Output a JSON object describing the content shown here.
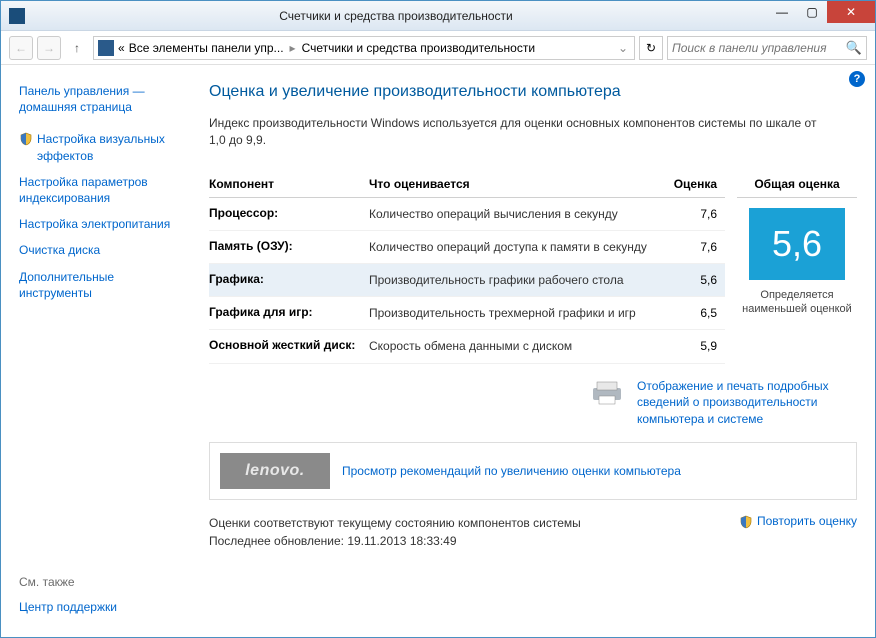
{
  "window": {
    "title": "Счетчики и средства производительности"
  },
  "breadcrumb": {
    "prefix": "«",
    "parent": "Все элементы панели упр...",
    "current": "Счетчики и средства производительности"
  },
  "search": {
    "placeholder": "Поиск в панели управления"
  },
  "sidebar": {
    "home": "Панель управления — домашняя страница",
    "items": [
      "Настройка визуальных эффектов",
      "Настройка параметров индексирования",
      "Настройка электропитания",
      "Очистка диска",
      "Дополнительные инструменты"
    ],
    "see_also": "См. также",
    "support": "Центр поддержки"
  },
  "main": {
    "heading": "Оценка и увеличение производительности компьютера",
    "intro": "Индекс производительности Windows используется для оценки основных компонентов системы по шкале от 1,0 до 9,9.",
    "headers": {
      "component": "Компонент",
      "description": "Что оценивается",
      "score": "Оценка",
      "overall": "Общая оценка"
    },
    "rows": [
      {
        "component": "Процессор:",
        "description": "Количество операций вычисления в секунду",
        "score": "7,6"
      },
      {
        "component": "Память (ОЗУ):",
        "description": "Количество операций доступа к памяти в секунду",
        "score": "7,6"
      },
      {
        "component": "Графика:",
        "description": "Производительность графики рабочего стола",
        "score": "5,6"
      },
      {
        "component": "Графика для игр:",
        "description": "Производительность трехмерной графики и игр",
        "score": "6,5"
      },
      {
        "component": "Основной жесткий диск:",
        "description": "Скорость обмена данными с диском",
        "score": "5,9"
      }
    ],
    "overall_score": "5,6",
    "overall_caption": "Определяется наименьшей оценкой",
    "detail_link": "Отображение и печать подробных сведений о производительности компьютера и системе",
    "reco": {
      "brand": "lenovo.",
      "link": "Просмотр рекомендаций по увеличению оценки компьютера"
    },
    "status_line1": "Оценки соответствуют текущему состоянию компонентов системы",
    "status_line2": "Последнее обновление: 19.11.2013 18:33:49",
    "rerun": "Повторить оценку"
  }
}
